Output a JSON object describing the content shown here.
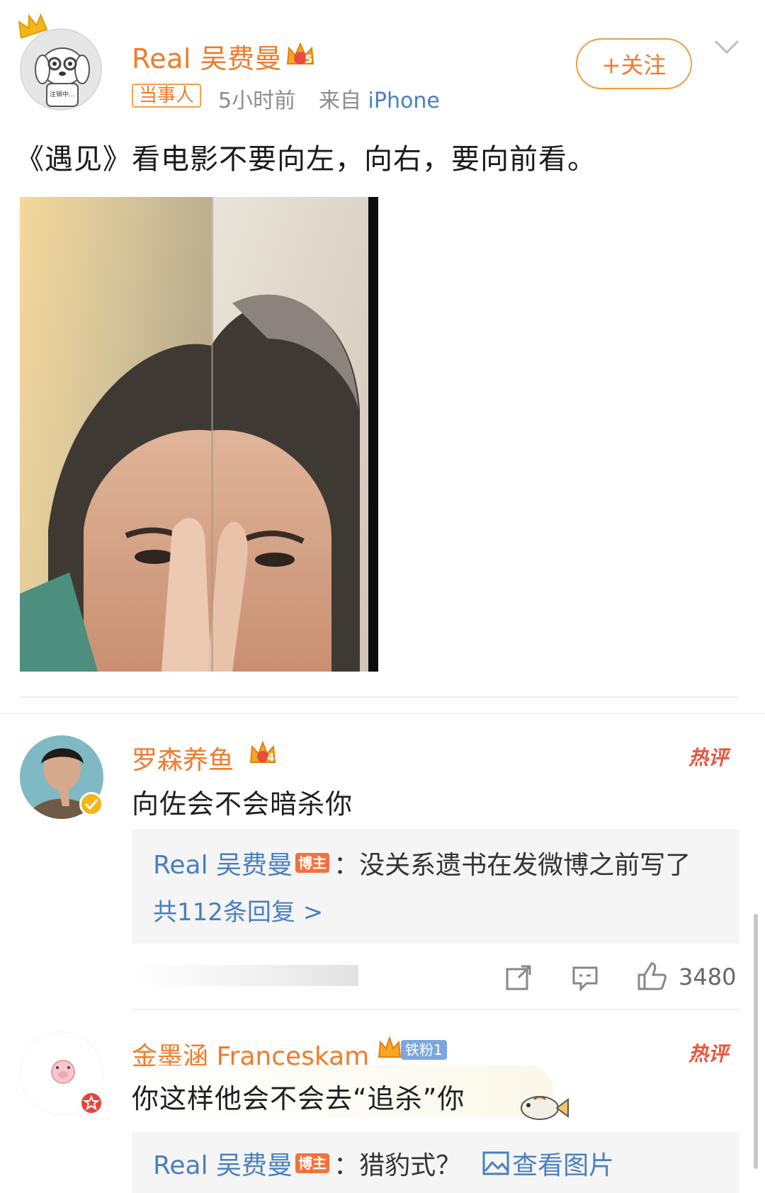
{
  "post": {
    "author": "Real 吴费曼",
    "tag": "当事人",
    "time": "5小时前",
    "source_prefix": "来自",
    "source": "iPhone",
    "follow_label": "+关注",
    "text": "《遇见》看电影不要向左，向右，要向前看。",
    "avatar_caption": "注销中...",
    "vip_level": "5"
  },
  "comments": [
    {
      "author": "罗森养鱼",
      "vip_level": "4",
      "hot_label": "热评",
      "text": "向佐会不会暗杀你",
      "reply": {
        "author": "Real 吴费曼",
        "badge": "博主",
        "text": "：没关系遗书在发微博之前写了"
      },
      "reply_count": "共112条回复 >",
      "likes": "3480"
    },
    {
      "author": "金墨涵 Franceskam",
      "fan_badge": "铁粉1",
      "hot_label": "热评",
      "text": "你这样他会不会去“追杀”你",
      "reply": {
        "author": "Real 吴费曼",
        "badge": "博主",
        "text": "：猎豹式？",
        "view_image": "查看图片"
      }
    }
  ],
  "colors": {
    "accent": "#f07b2a",
    "link": "#4a7fc1",
    "hot": "#e8563c"
  }
}
